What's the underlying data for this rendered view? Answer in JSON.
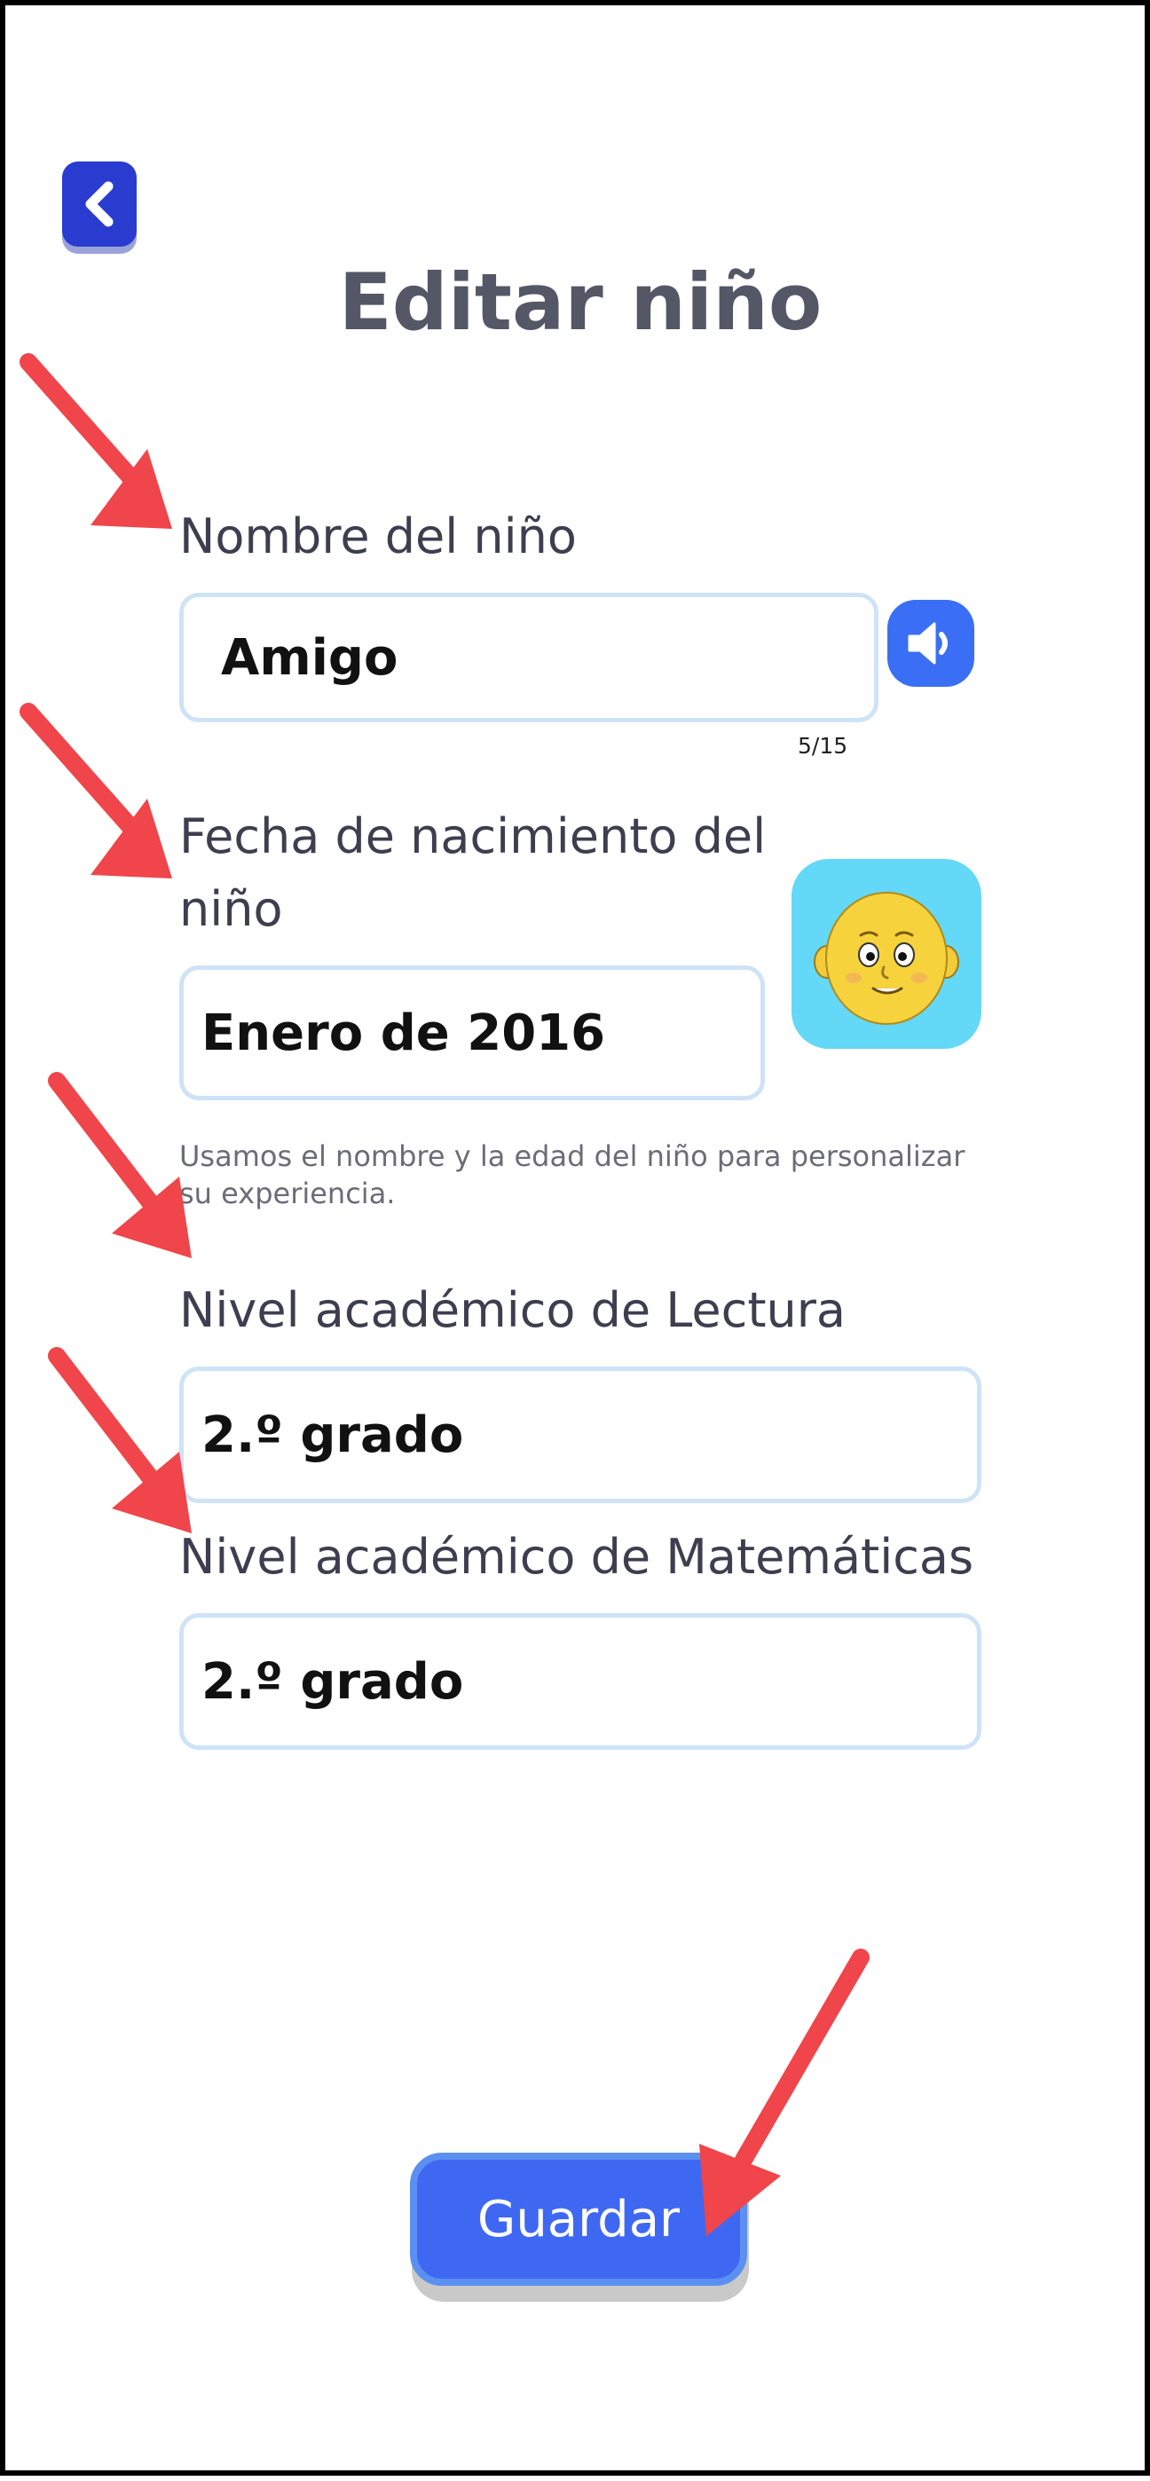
{
  "header": {
    "back_icon": "chevron-left-icon",
    "title": "Editar niño"
  },
  "form": {
    "name": {
      "label": "Nombre del niño",
      "value": "Amigo",
      "counter": "5/15",
      "speaker_icon": "speaker-icon"
    },
    "birthdate": {
      "label_line1": "Fecha de nacimiento del",
      "label_line2": "niño",
      "value": "Enero de 2016",
      "avatar": "baby-face-avatar"
    },
    "help_text": "Usamos el nombre y la edad del niño para personalizar su experiencia.",
    "reading_level": {
      "label": "Nivel académico de Lectura",
      "value": "2.º grado"
    },
    "math_level": {
      "label": "Nivel académico de Matemáticas",
      "value": "2.º grado"
    }
  },
  "actions": {
    "save_label": "Guardar"
  },
  "colors": {
    "accent_blue": "#3e68f2",
    "back_button": "#2a3bd0",
    "avatar_bg": "#64d8f7",
    "field_border": "#cfe3f7",
    "annotation_arrow": "#f0454a"
  }
}
